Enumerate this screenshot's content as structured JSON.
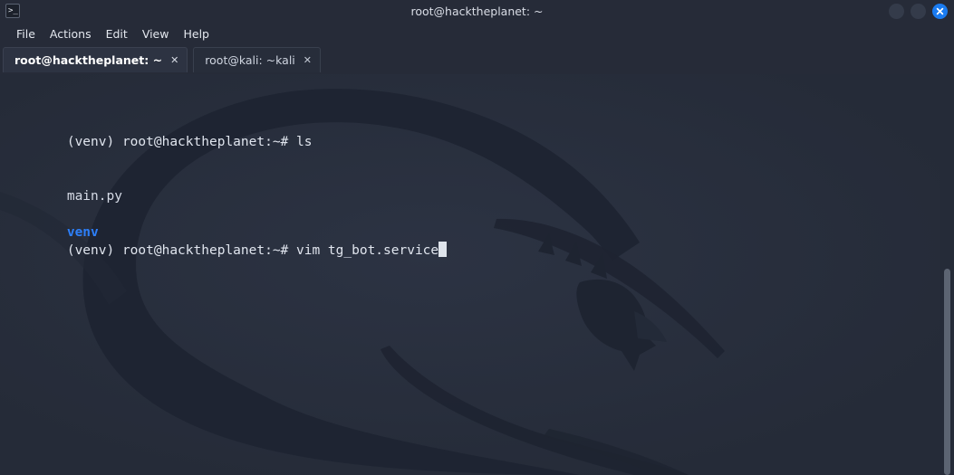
{
  "window": {
    "title": "root@hacktheplanet: ~",
    "icon": "terminal-icon",
    "icon_glyph": ">_",
    "controls": [
      {
        "name": "minimize-button",
        "label": ""
      },
      {
        "name": "maximize-button",
        "label": ""
      },
      {
        "name": "close-button",
        "label": "✕"
      }
    ],
    "accent_close_color": "#1a7bf0",
    "titlebar_color": "#262b38"
  },
  "menubar": {
    "items": [
      {
        "label": "File"
      },
      {
        "label": "Actions"
      },
      {
        "label": "Edit"
      },
      {
        "label": "View"
      },
      {
        "label": "Help"
      }
    ]
  },
  "tabs": [
    {
      "label": "root@hacktheplanet: ~",
      "close_glyph": "✕",
      "active": true
    },
    {
      "label": "root@kali: ~kali",
      "close_glyph": "✕",
      "active": false
    }
  ],
  "terminal": {
    "background_color": "#252b38",
    "foreground_color": "#d6dbe6",
    "directory_color": "#2d7ff9",
    "cursor_color": "#dfe4ec",
    "wallpaper": "kali-dragon-watermark",
    "lines": [
      {
        "segments": [
          {
            "text": "(venv) root@hacktheplanet:~# ls",
            "style": "prompt"
          }
        ]
      },
      {
        "segments": [
          {
            "text": "main.py",
            "style": "file"
          },
          {
            "text": "  ",
            "style": "file"
          },
          {
            "text": "venv",
            "style": "dir"
          }
        ]
      },
      {
        "segments": [
          {
            "text": "(venv) root@hacktheplanet:~# vim tg_bot.service",
            "style": "prompt"
          },
          {
            "text": "",
            "style": "cursor"
          }
        ]
      }
    ]
  },
  "scrollbar": {
    "thumb_color": "#5c6472",
    "track_color": "#252b38"
  }
}
